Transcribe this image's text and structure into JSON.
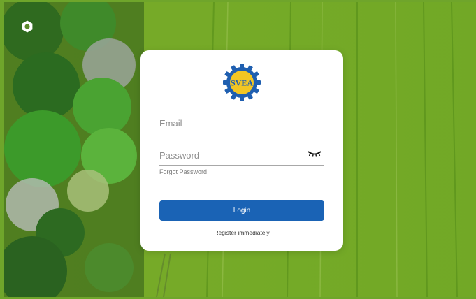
{
  "background": {
    "scene": "aerial view of trees and green field"
  },
  "corner_button": {
    "icon": "gear-icon"
  },
  "login_card": {
    "logo": {
      "brand": "SVEA",
      "icon": "gear-logo",
      "colors": {
        "gear": "#1f5fb0",
        "inner": "#f3c623",
        "text": "#1f5fb0"
      }
    },
    "email": {
      "placeholder": "Email",
      "value": ""
    },
    "password": {
      "placeholder": "Password",
      "value": "",
      "toggle_icon": "eye-closed-icon"
    },
    "forgot_password_label": "Forgot Password",
    "login_label": "Login",
    "register_label": "Register immediately"
  },
  "colors": {
    "primary_button": "#1a63b5",
    "card_background": "#ffffff"
  }
}
